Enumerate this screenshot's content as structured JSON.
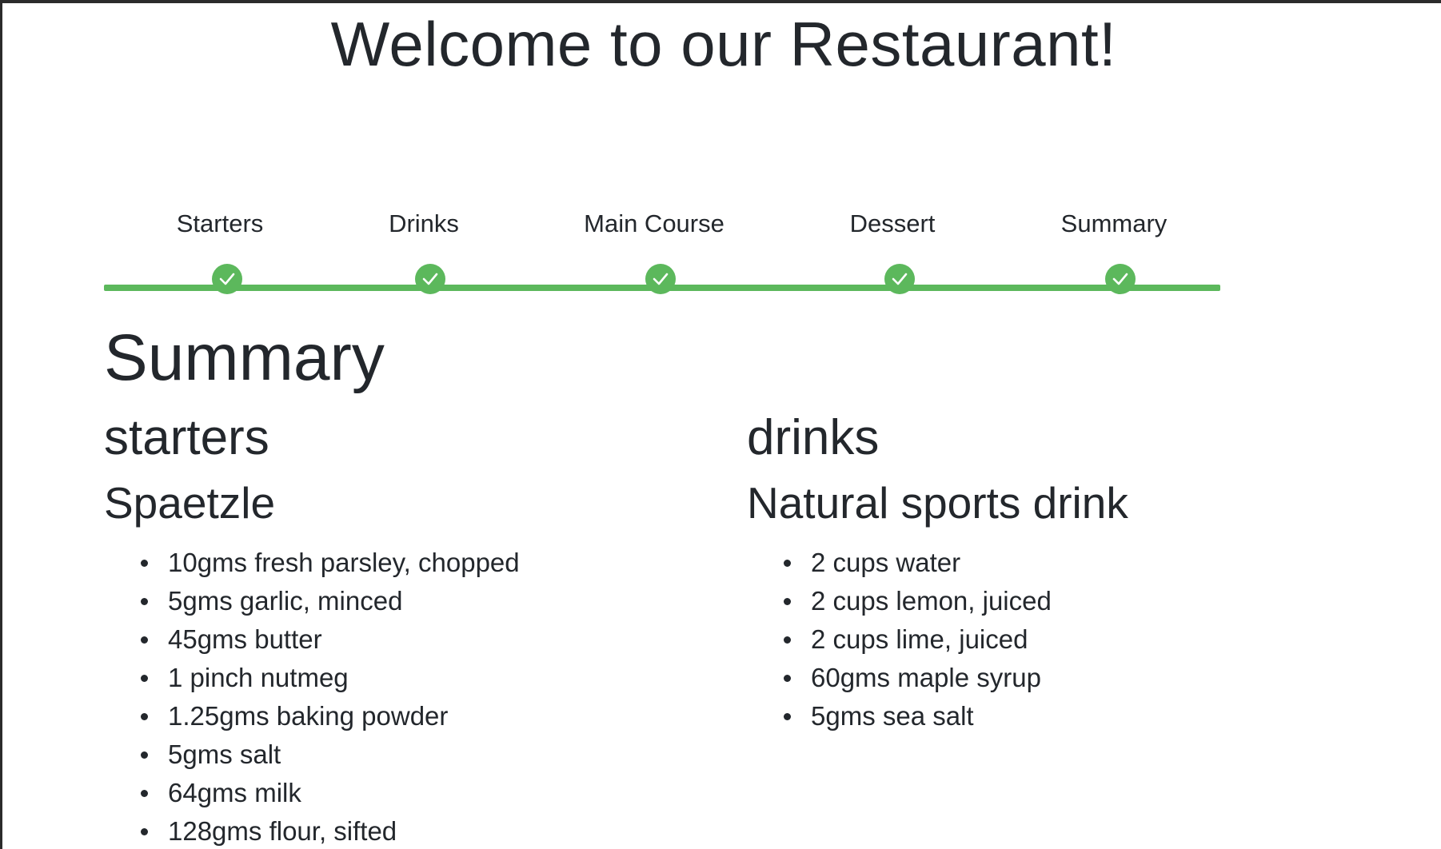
{
  "page": {
    "title": "Welcome to our Restaurant!"
  },
  "stepper": {
    "accent_color": "#5cb85c",
    "completed_icon": "check-icon",
    "steps": [
      {
        "label": "Starters",
        "completed": true
      },
      {
        "label": "Drinks",
        "completed": true
      },
      {
        "label": "Main Course",
        "completed": true
      },
      {
        "label": "Dessert",
        "completed": true
      },
      {
        "label": "Summary",
        "completed": true
      }
    ]
  },
  "summary": {
    "heading": "Summary",
    "sections": [
      {
        "category": "starters",
        "dish": "Spaetzle",
        "ingredients": [
          "10gms fresh parsley, chopped",
          "5gms garlic, minced",
          "45gms butter",
          "1 pinch nutmeg",
          "1.25gms baking powder",
          "5gms salt",
          "64gms milk",
          "128gms flour, sifted"
        ]
      },
      {
        "category": "drinks",
        "dish": "Natural sports drink",
        "ingredients": [
          "2 cups water",
          "2 cups lemon, juiced",
          "2 cups lime, juiced",
          "60gms maple syrup",
          "5gms sea salt"
        ]
      }
    ]
  }
}
